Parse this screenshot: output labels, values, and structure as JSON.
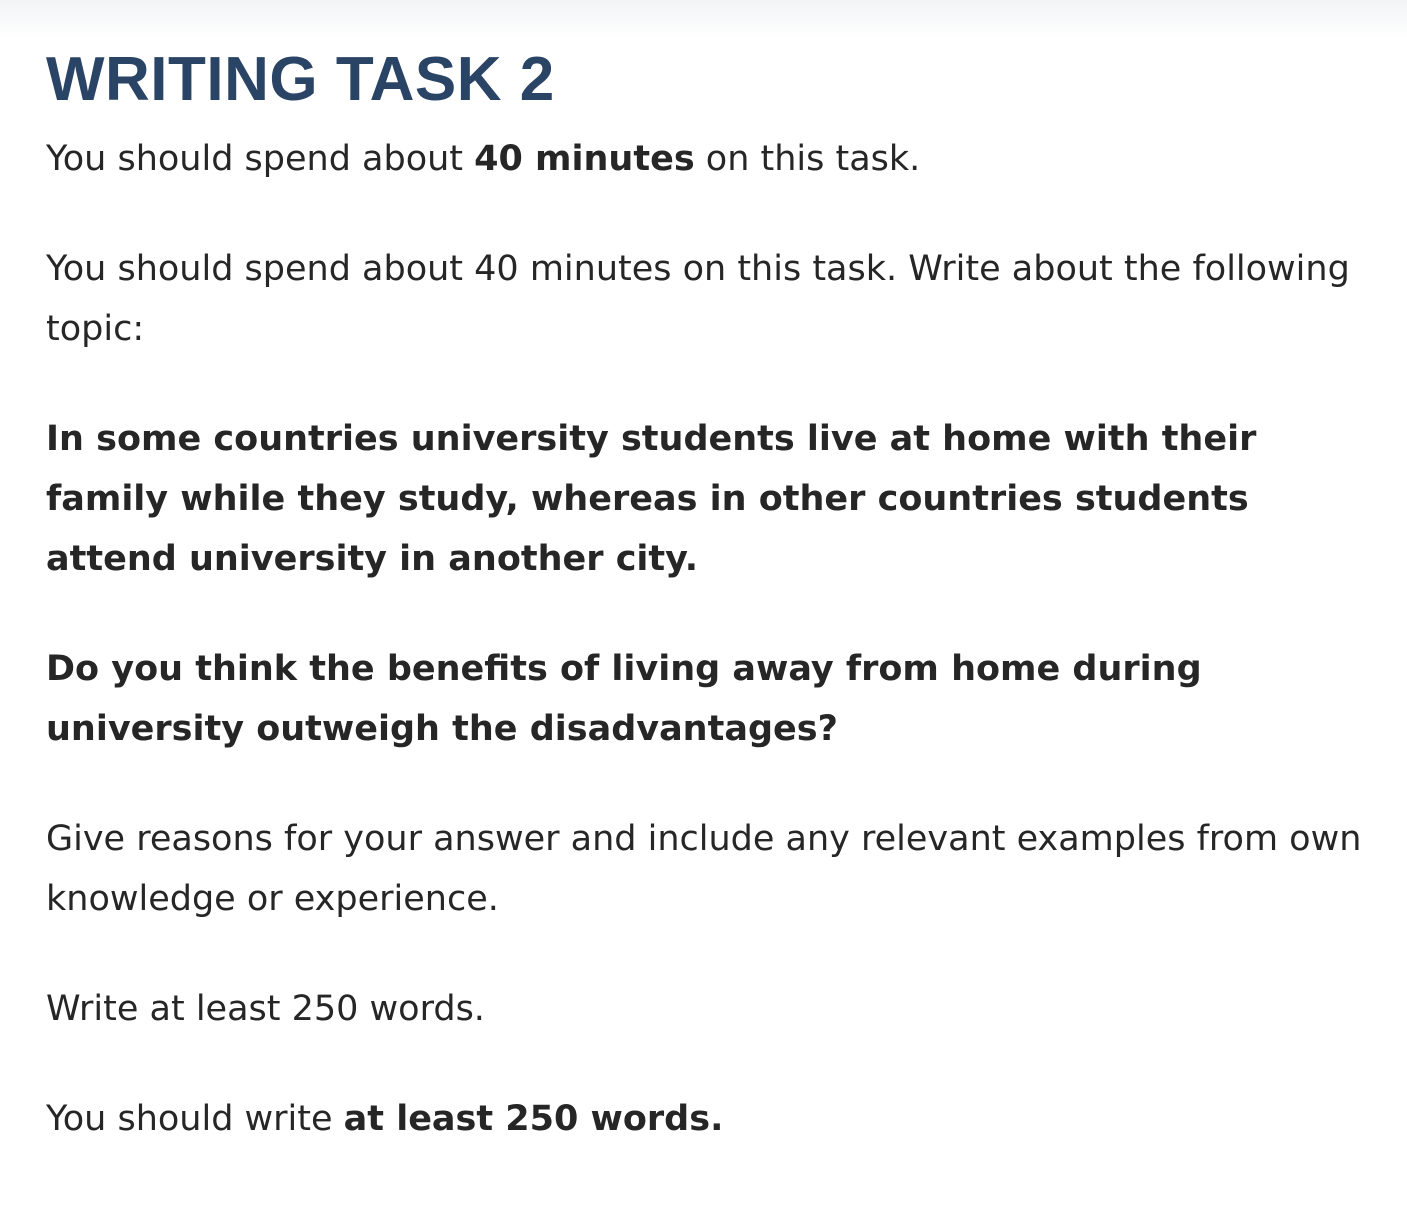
{
  "task": {
    "title": "WRITING TASK 2",
    "intro": {
      "before": "You should spend about ",
      "bold": "40 minutes",
      "after": " on this task."
    },
    "instruction": "You should spend about 40 minutes on this task. Write about the following topic:",
    "topic_statement": "In some countries university students live at home with their family while they study, whereas in other countries students attend university in another city.",
    "topic_question": "Do you think the benefits of living away from home during university outweigh the disadvantages?",
    "reasons": "Give reasons for your answer and include any relevant examples from own knowledge or experience.",
    "word_limit": "Write at least 250 words.",
    "final": {
      "before": "You should write ",
      "bold": "at least 250 words."
    }
  }
}
